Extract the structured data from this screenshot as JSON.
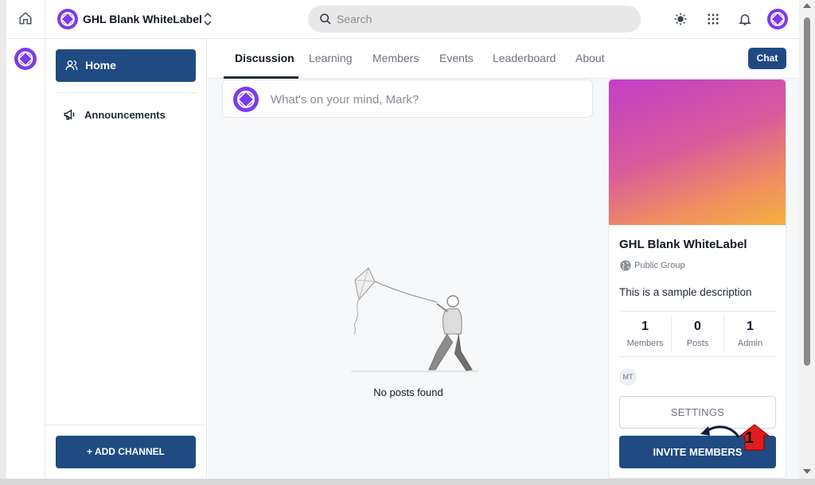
{
  "header": {
    "group_name": "GHL Blank WhiteLabel",
    "search_placeholder": "Search",
    "icons": [
      "home-icon",
      "theme-toggle-icon",
      "apps-grid-icon",
      "bell-icon",
      "avatar"
    ]
  },
  "sidebar": {
    "items": [
      {
        "label": "Home",
        "icon": "users-icon",
        "active": true
      },
      {
        "label": "Announcements",
        "icon": "megaphone-icon",
        "active": false
      }
    ],
    "add_channel_label": "+ ADD CHANNEL"
  },
  "tabs": [
    {
      "label": "Discussion",
      "active": true
    },
    {
      "label": "Learning"
    },
    {
      "label": "Members"
    },
    {
      "label": "Events"
    },
    {
      "label": "Leaderboard"
    },
    {
      "label": "About"
    }
  ],
  "chat_label": "Chat",
  "composer": {
    "placeholder": "What's on your mind, Mark?"
  },
  "feed": {
    "empty_text": "No posts found"
  },
  "group_card": {
    "title": "GHL Blank WhiteLabel",
    "visibility": "Public Group",
    "description": "This is a sample description",
    "stats": [
      {
        "value": "1",
        "label": "Members"
      },
      {
        "value": "0",
        "label": "Posts"
      },
      {
        "value": "1",
        "label": "Admin"
      }
    ],
    "member_initials": "MT",
    "settings_label": "SETTINGS",
    "invite_label": "INVITE MEMBERS"
  },
  "annotation": {
    "number": "1"
  },
  "colors": {
    "primary": "#1f4b82",
    "logo": "#7c3aed",
    "banner_gradient": [
      "#c33fc7",
      "#ef8d62",
      "#f3b13f"
    ]
  }
}
